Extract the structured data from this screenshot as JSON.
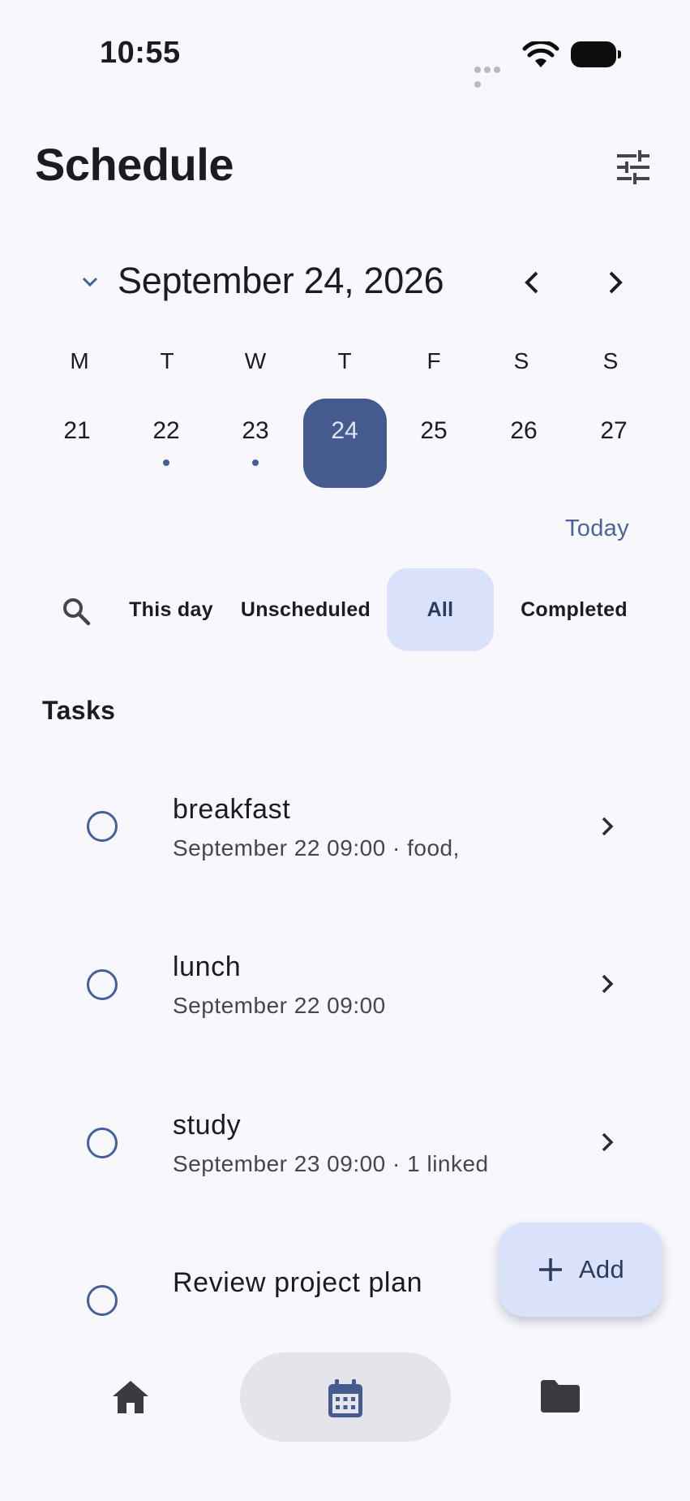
{
  "status_bar": {
    "time": "10:55"
  },
  "header": {
    "title": "Schedule",
    "settings_icon": "tune-icon"
  },
  "calendar": {
    "month_label": "September 24, 2026",
    "weekdays": [
      "M",
      "T",
      "W",
      "T",
      "F",
      "S",
      "S"
    ],
    "days": [
      "21",
      "22",
      "23",
      "24",
      "25",
      "26",
      "27"
    ],
    "selected_day": "24",
    "days_with_events": [
      "22",
      "23"
    ],
    "today_label": "Today"
  },
  "filters": {
    "items": [
      "This day",
      "Unscheduled",
      "All",
      "Completed"
    ],
    "active": "All"
  },
  "tasks_section": {
    "title": "Tasks",
    "items": [
      {
        "name": "breakfast",
        "meta": "September 22 09:00 · food,"
      },
      {
        "name": "lunch",
        "meta": "September 22 09:00"
      },
      {
        "name": "study",
        "meta": "September 23 09:00 · 1 linked"
      },
      {
        "name": "Review project plan",
        "meta": ""
      }
    ]
  },
  "fab": {
    "label": "Add"
  },
  "bottom_nav": {
    "items": [
      "home-icon",
      "calendar-icon",
      "folder-icon"
    ],
    "active": "calendar-icon"
  },
  "colors": {
    "accent": "#455a8e",
    "chip_active": "#d9e2fa",
    "background": "#f7f7fc"
  }
}
